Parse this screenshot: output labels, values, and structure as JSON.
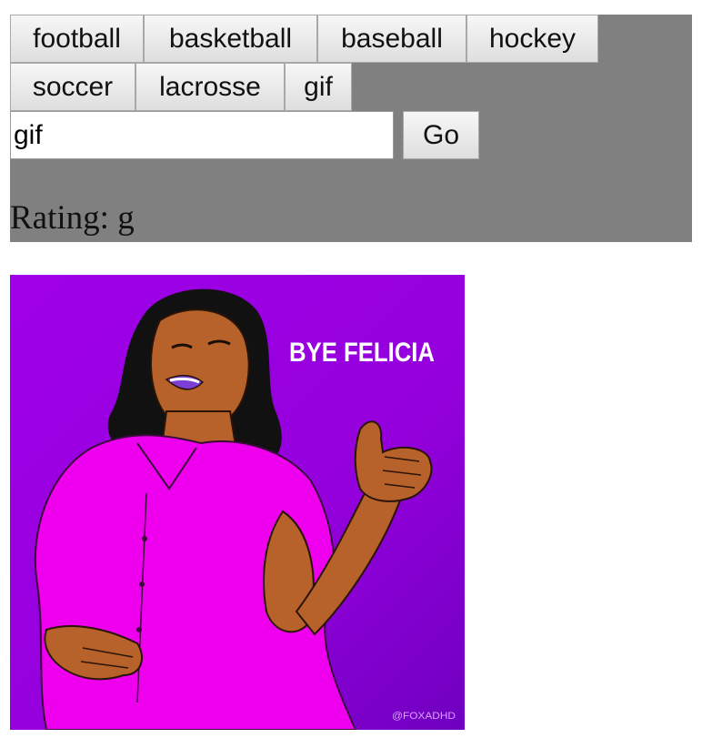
{
  "topics": [
    {
      "label": "football"
    },
    {
      "label": "basketball"
    },
    {
      "label": "baseball"
    },
    {
      "label": "hockey"
    },
    {
      "label": "soccer"
    },
    {
      "label": "lacrosse"
    },
    {
      "label": "gif"
    }
  ],
  "search": {
    "value": "gif",
    "go_label": "Go"
  },
  "rating": {
    "text": "Rating: g"
  },
  "gif": {
    "caption": "BYE FELICIA",
    "watermark": "@FOXADHD",
    "colors": {
      "background": "#9a00e0",
      "dress": "#ee00ee",
      "skin": "#b8622b",
      "hair": "#111111",
      "lips": "#7b3fd6",
      "caption": "#ffffff"
    }
  }
}
